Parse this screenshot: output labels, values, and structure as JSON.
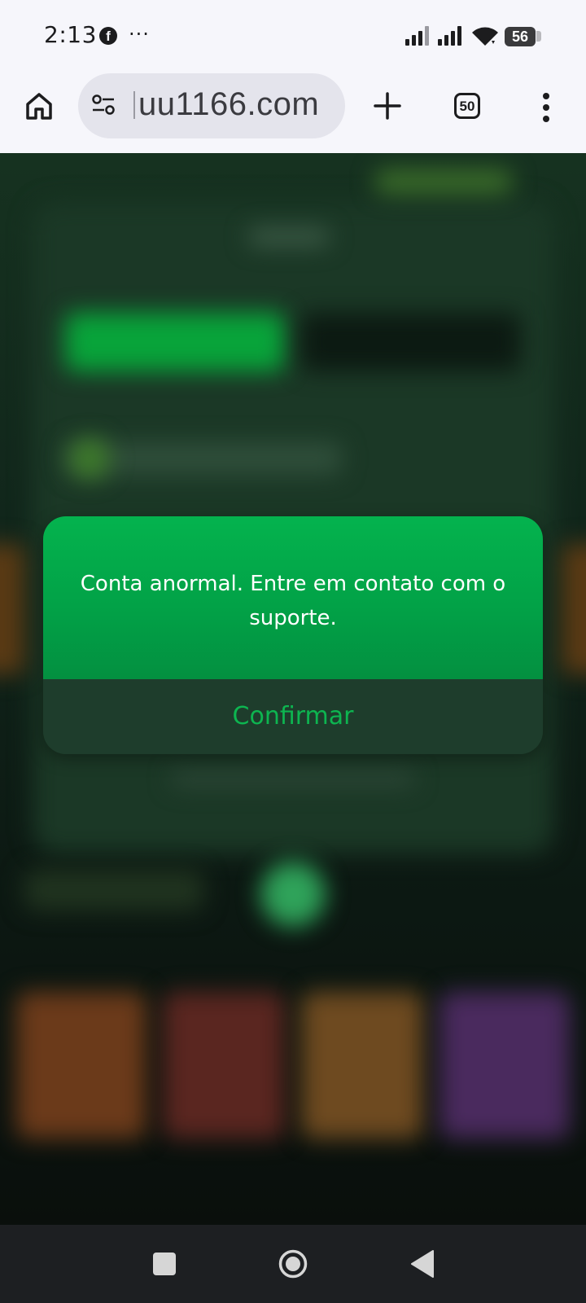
{
  "status_bar": {
    "time": "2:13",
    "facebook_icon": "f",
    "more_notifications": "···",
    "battery_level": "56"
  },
  "browser": {
    "url": "uu1166.com",
    "tab_count": "50"
  },
  "modal": {
    "message": "Conta anormal. Entre em contato com o suporte.",
    "confirm_label": "Confirmar"
  },
  "colors": {
    "modal_green": "#04b34e",
    "footer_green": "#1e3d2c",
    "confirm_text": "#0db550"
  }
}
